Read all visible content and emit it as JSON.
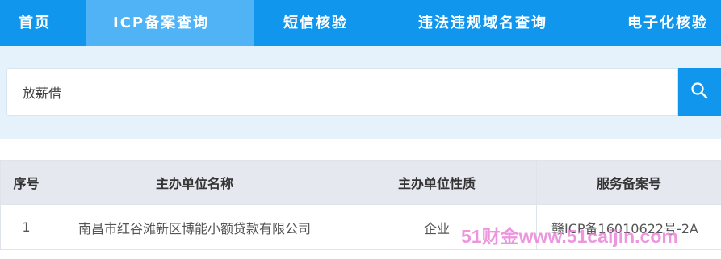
{
  "nav": {
    "items": [
      {
        "label": "首页",
        "active": false
      },
      {
        "label": "ICP备案查询",
        "active": true
      },
      {
        "label": "短信核验",
        "active": false
      },
      {
        "label": "违法违规域名查询",
        "active": false
      },
      {
        "label": "电子化核验",
        "active": false
      }
    ]
  },
  "search": {
    "value": "放薪借",
    "icon": "search-icon"
  },
  "table": {
    "columns": [
      "序号",
      "主办单位名称",
      "主办单位性质",
      "服务备案号"
    ],
    "rows": [
      [
        "1",
        "南昌市红谷滩新区博能小额贷款有限公司",
        "企业",
        "赣ICP备16010622号-2A"
      ]
    ]
  },
  "watermark": "51财金www.51caijin.com",
  "colors": {
    "nav_bg": "#1196ee",
    "nav_active": "#4fb3f6",
    "search_band": "#e6f2fb",
    "header_bg": "#e6e8f0"
  }
}
